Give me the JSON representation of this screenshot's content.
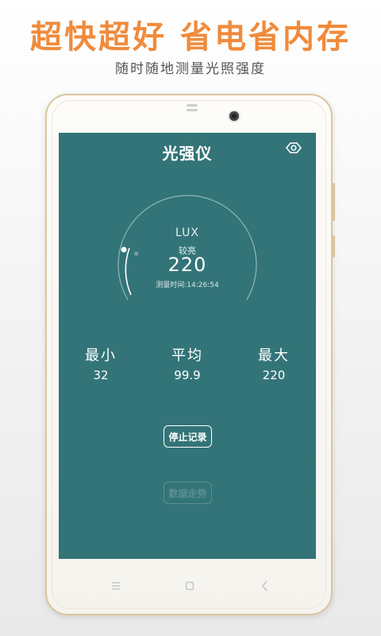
{
  "promo": {
    "headline": "超快超好  省电省内存",
    "subline": "随时随地测量光照强度"
  },
  "app": {
    "title": "光强仪",
    "header_icon": "eye-icon",
    "gauge": {
      "unit": "LUX",
      "level": "较亮",
      "value": "220",
      "time": "测量时间:14:26:54"
    },
    "stats": {
      "min": {
        "label": "最小",
        "value": "32"
      },
      "avg": {
        "label": "平均",
        "value": "99.9"
      },
      "max": {
        "label": "最大",
        "value": "220"
      }
    },
    "buttons": {
      "stop": "停止记录",
      "trend": "数据走势"
    }
  },
  "navbar": {
    "icons": [
      "menu-icon",
      "home-icon",
      "back-icon"
    ]
  },
  "colors": {
    "accent": "#f08b3c",
    "screen_bg": "#337478",
    "phone_trim": "#dcc5a0",
    "disabled": "#5c8f93"
  }
}
